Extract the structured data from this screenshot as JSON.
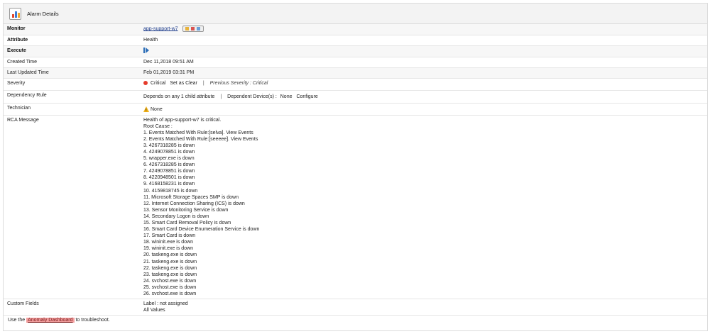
{
  "header": {
    "title": "Alarm Details",
    "icon": "alarm-details-icon"
  },
  "rows": {
    "monitor": {
      "label": "Monitor",
      "value": "app-support-w7"
    },
    "attribute": {
      "label": "Attribute",
      "value": "Health"
    },
    "execute": {
      "label": "Execute"
    },
    "created": {
      "label": "Created  Time",
      "value": "Dec 11,2018 09:51 AM"
    },
    "updated": {
      "label": "Last Updated  Time",
      "value": "Feb 01,2019 03:31 PM"
    },
    "severity": {
      "label": "Severity",
      "status": "Critical",
      "set_clear": "Set as Clear",
      "sep": "|",
      "previous_label": "Previous Severity :",
      "previous_value": "Critical"
    },
    "dependency": {
      "label": "Dependency Rule",
      "rule": "Depends on any 1 child attribute",
      "sep": "|",
      "devices_label": "Dependent Device(s) :",
      "devices_value": "None",
      "configure": "Configure"
    },
    "technician": {
      "label": "Technician",
      "value": "None"
    },
    "rca": {
      "label": "RCA Message",
      "intro": "Health of app-support-w7 is critical.",
      "root_cause": "Root Cause :",
      "items": [
        "1. Events Matched With Rule:[selva]. View Events",
        "2. Events Matched With Rule:[seeeee]. View Events",
        "3. 4267318285 is down",
        "4. 4249078851 is down",
        "5. wrapper.exe is down",
        "6. 4267318285 is down",
        "7. 4249078851 is down",
        "8. 4220948501 is down",
        "9. 4168158231 is down",
        "10. 4159818745 is down",
        "11. Microsoft Storage Spaces SMP is down",
        "12. Internet Connection Sharing (ICS) is down",
        "13. Sensor Monitoring Service is down",
        "14. Secondary Logon is down",
        "15. Smart Card Removal Policy is down",
        "16. Smart Card Device Enumeration Service is down",
        "17. Smart Card is down",
        "18. wininit.exe is down",
        "19. wininit.exe is down",
        "20. taskeng.exe is down",
        "21. taskeng.exe is down",
        "22. taskeng.exe is down",
        "23. taskeng.exe is down",
        "24. svchost.exe is down",
        "25. svchost.exe is down",
        "26. svchost.exe is down"
      ]
    },
    "custom": {
      "label": "Custom Fields",
      "line1": "Label : not assigned",
      "line2": "All Values"
    }
  },
  "footer": {
    "prefix": "Use the",
    "link": "Anomaly Dashboard",
    "suffix": "to troubleshoot."
  },
  "colors": {
    "critical": "#e53b2c",
    "anomaly_bg": "#f4a0a0",
    "link": "#1b3a8a"
  }
}
